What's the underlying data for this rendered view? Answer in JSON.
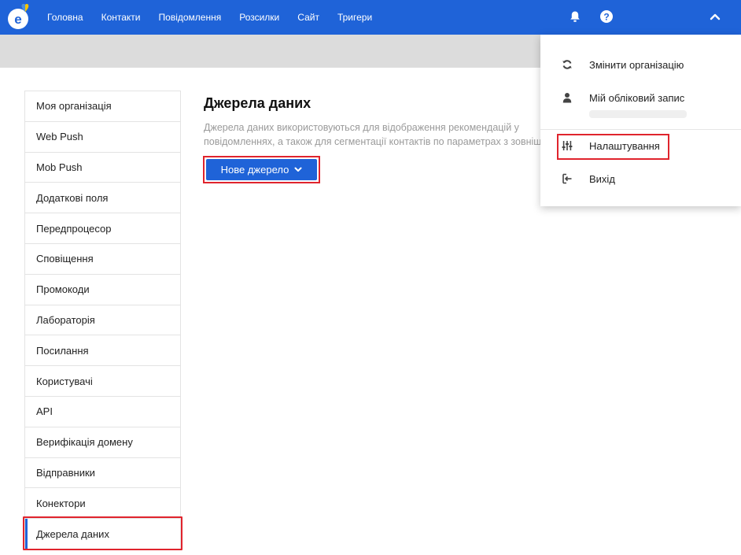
{
  "nav": {
    "items": [
      "Головна",
      "Контакти",
      "Повідомлення",
      "Розсилки",
      "Сайт",
      "Тригери"
    ]
  },
  "icons": {
    "logo": "esputnik-logo",
    "notifications": "bell-icon",
    "help": "help-icon",
    "menu_toggle": "chevron-up-icon"
  },
  "colors": {
    "primary": "#1f63d8",
    "highlight": "#e0242d",
    "band": "#dcdcdc",
    "muted_text": "#9a9a9a"
  },
  "sidebar": {
    "items": [
      "Моя організація",
      "Web Push",
      "Mob Push",
      "Додаткові поля",
      "Передпроцесор",
      "Сповіщення",
      "Промокоди",
      "Лабораторія",
      "Посилання",
      "Користувачі",
      "API",
      "Верифікація домену",
      "Відправники",
      "Конектори",
      "Джерела даних"
    ],
    "active_index": 14
  },
  "main": {
    "title": "Джерела даних",
    "description_line1": "Джерела даних використовуються для відображення рекомендацій у",
    "description_line2": "повідомленнях, а також для сегментації контактів по параметрах з зовнішніх джерел",
    "new_source_button": "Нове джерело"
  },
  "dropdown": {
    "change_org": "Змінити організацію",
    "my_account": "Мій обліковий запис",
    "settings": "Налаштування",
    "logout": "Вихід"
  }
}
